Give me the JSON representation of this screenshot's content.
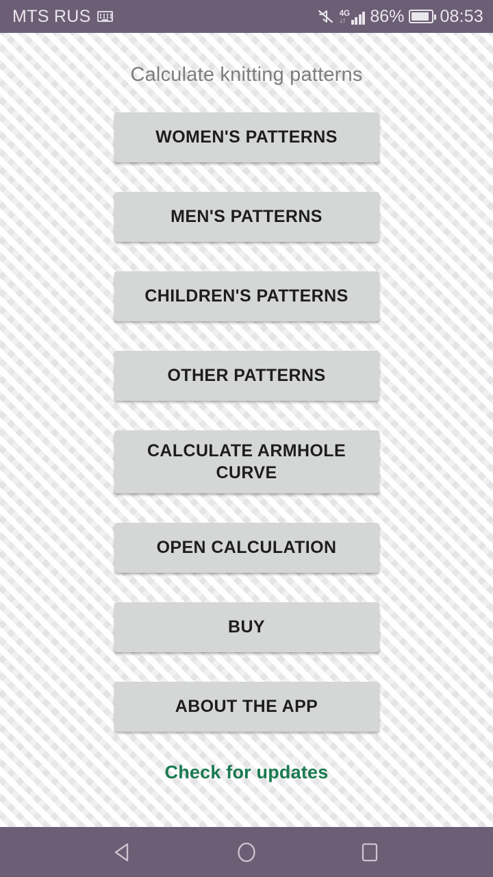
{
  "status_bar": {
    "carrier": "MTS RUS",
    "keyboard_icon": "keyboard-icon",
    "mute_icon": "mute-icon",
    "network_generation": "4G",
    "network_arrows": "↓↑",
    "signal_icon": "signal-bars-icon",
    "battery_percent": "86%",
    "battery_icon": "battery-icon",
    "clock": "08:53"
  },
  "page": {
    "title": "Calculate knitting patterns",
    "background_color": "#f3f3f3",
    "accent_color": "#6c5e75",
    "button_color": "#d5d6d6",
    "link_color": "#1a7a51"
  },
  "buttons": [
    {
      "label": "WOMEN'S PATTERNS",
      "name": "womens-patterns-button",
      "lines": 1
    },
    {
      "label": "MEN'S PATTERNS",
      "name": "mens-patterns-button",
      "lines": 1
    },
    {
      "label": "CHILDREN'S PATTERNS",
      "name": "childrens-patterns-button",
      "lines": 1
    },
    {
      "label": "OTHER PATTERNS",
      "name": "other-patterns-button",
      "lines": 1
    },
    {
      "label": "CALCULATE ARMHOLE CURVE",
      "name": "calculate-armhole-curve-button",
      "lines": 2
    },
    {
      "label": "OPEN CALCULATION",
      "name": "open-calculation-button",
      "lines": 1
    },
    {
      "label": "BUY",
      "name": "buy-button",
      "lines": 1
    },
    {
      "label": "ABOUT THE APP",
      "name": "about-the-app-button",
      "lines": 1
    }
  ],
  "update_link": {
    "label": "Check for updates"
  },
  "nav_bar": {
    "back_icon": "back-triangle-icon",
    "home_icon": "home-circle-icon",
    "recents_icon": "recents-square-icon"
  }
}
